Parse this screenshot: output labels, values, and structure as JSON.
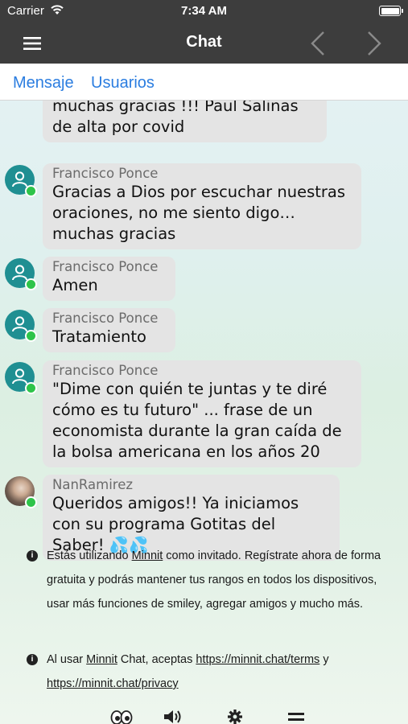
{
  "status_bar": {
    "carrier": "Carrier",
    "time": "7:34 AM"
  },
  "nav": {
    "title": "Chat"
  },
  "tabs": [
    {
      "label": "Mensaje"
    },
    {
      "label": "Usuarios"
    }
  ],
  "messages": [
    {
      "author": "",
      "text": "bien, todos dados de alta muchas gracias !!! Paul Salinas de alta por covid"
    },
    {
      "author": "Francisco Ponce",
      "text": "Gracias a Dios por escuchar nuestras oraciones, no me siento digo… muchas gracias"
    },
    {
      "author": "Francisco Ponce",
      "text": "Amen"
    },
    {
      "author": "Francisco Ponce",
      "text": "Tratamiento"
    },
    {
      "author": "Francisco Ponce",
      "text": "\"Dime con quién te juntas y te diré cómo es tu futuro\" ... frase de un economista durante la gran caída de la bolsa americana en los años 20"
    },
    {
      "author": "NanRamirez",
      "text": "Queridos amigos!! Ya iniciamos con su programa Gotitas del Saber! 💦💦"
    }
  ],
  "info_guest": {
    "pre": "Estás utilizando ",
    "link": "Minnit",
    "post": " como invitado. Regístrate ahora de forma gratuita y podrás mantener tus rangos en todos los dispositivos, usar más funciones de smiley, agregar amigos y mucho más."
  },
  "info_terms": {
    "pre": "Al usar ",
    "link1": "Minnit",
    "mid": " Chat, aceptas ",
    "link2": "https://minnit.chat/terms",
    "mid2": " y ",
    "link3": "https://minnit.chat/privacy"
  },
  "toolbar_icons": [
    "eyes-icon",
    "speaker-icon",
    "gear-icon",
    "menu-icon"
  ],
  "colors": {
    "bar": "#3d3d3d",
    "tab_link": "#2b7de0",
    "bubble": "#e4e4e4",
    "online": "#2ec44a",
    "avatar": "#1f8f92"
  }
}
